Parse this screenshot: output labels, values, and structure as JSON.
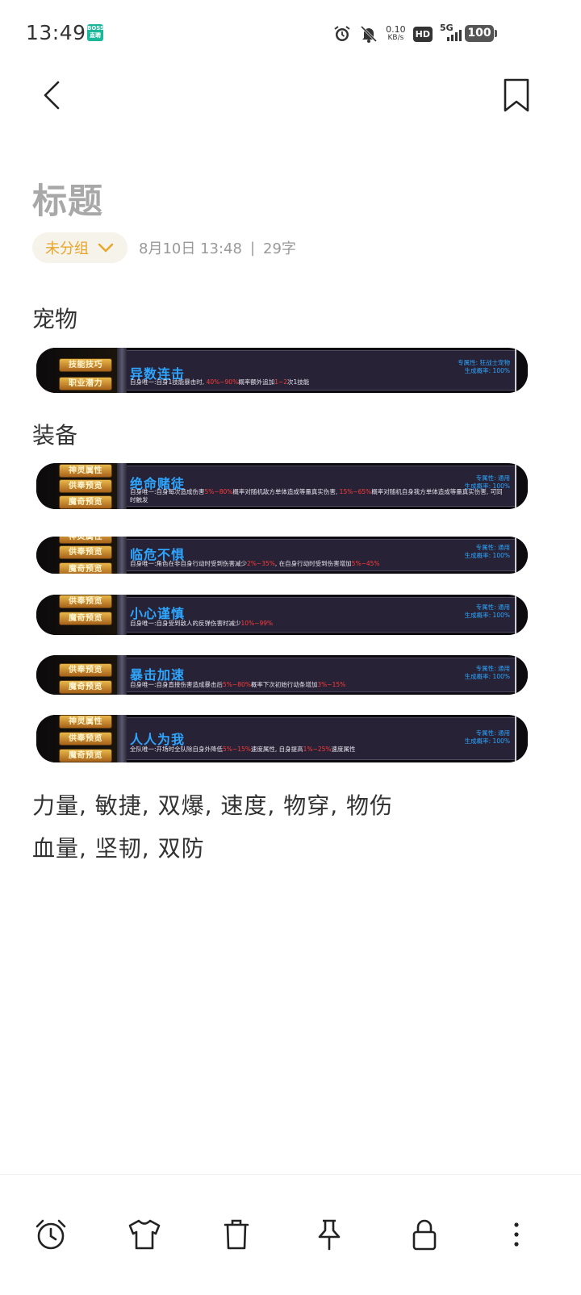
{
  "status_bar": {
    "time": "13:49",
    "app_badge_top": "BOSS",
    "app_badge_bottom": "直聘",
    "net_speed_value": "0.10",
    "net_speed_unit": "KB/s",
    "hd_label": "HD",
    "network": "5G",
    "battery": "100"
  },
  "note": {
    "title": "标题",
    "group": "未分组",
    "date": "8月10日 13:48",
    "separator": "|",
    "word_count": "29字"
  },
  "sections": [
    {
      "heading": "宠物"
    },
    {
      "heading": "装备"
    }
  ],
  "cards": [
    {
      "buttons": [
        "技能技巧",
        "职业潜力"
      ],
      "name": "异数连击",
      "desc": [
        {
          "t": "自身唯一:自身1技能暴击时, ",
          "hl": false
        },
        {
          "t": "40%~90%",
          "hl": true
        },
        {
          "t": "概率额外追加",
          "hl": false
        },
        {
          "t": "1~2",
          "hl": true
        },
        {
          "t": "次1技能",
          "hl": false
        }
      ],
      "attr_line1": "专属性: 狂战士宠物",
      "attr_line2": "生成概率: 100%"
    },
    {
      "buttons": [
        "神灵属性",
        "供奉预览",
        "魔奇预览"
      ],
      "name": "绝命赌徒",
      "desc": [
        {
          "t": "自身唯一:自身每次造成伤害",
          "hl": false
        },
        {
          "t": "5%~80%",
          "hl": true
        },
        {
          "t": "概率对随机敌方单体造成等量真实伤害, ",
          "hl": false
        },
        {
          "t": "15%~65%",
          "hl": true
        },
        {
          "t": "概率对随机自身我方单体造成等量真实伤害, 可同时触发",
          "hl": false
        }
      ],
      "attr_line1": "专属性: 通用",
      "attr_line2": "生成概率: 100%"
    },
    {
      "buttons": [
        "神灵属性",
        "供奉预览",
        "魔奇预览"
      ],
      "name": "临危不惧",
      "desc": [
        {
          "t": "自身唯一:角色在非自身行动时受到伤害减少",
          "hl": false
        },
        {
          "t": "2%~35%",
          "hl": true
        },
        {
          "t": ", 在自身行动时受到伤害增加",
          "hl": false
        },
        {
          "t": "5%~45%",
          "hl": true
        }
      ],
      "attr_line1": "专属性: 通用",
      "attr_line2": "生成概率: 100%"
    },
    {
      "buttons": [
        "供奉预览",
        "魔奇预览"
      ],
      "name": "小心谨慎",
      "desc": [
        {
          "t": "自身唯一:自身受到敌人的反弹伤害时减少",
          "hl": false
        },
        {
          "t": "10%~99%",
          "hl": true
        }
      ],
      "attr_line1": "专属性: 通用",
      "attr_line2": "生成概率: 100%"
    },
    {
      "buttons": [
        "供奉预览",
        "魔奇预览"
      ],
      "name": "暴击加速",
      "desc": [
        {
          "t": "自身唯一:自身直接伤害造成暴击后",
          "hl": false
        },
        {
          "t": "5%~80%",
          "hl": true
        },
        {
          "t": "概率下次初始行动条增加",
          "hl": false
        },
        {
          "t": "3%~15%",
          "hl": true
        }
      ],
      "attr_line1": "专属性: 通用",
      "attr_line2": "生成概率: 100%"
    },
    {
      "buttons": [
        "神灵属性",
        "供奉预览",
        "魔奇预览"
      ],
      "name": "人人为我",
      "desc": [
        {
          "t": "全队唯一:开场时全队除自身外降低",
          "hl": false
        },
        {
          "t": "5%~15%",
          "hl": true
        },
        {
          "t": "速度属性, 自身提高",
          "hl": false
        },
        {
          "t": "1%~25%",
          "hl": true
        },
        {
          "t": "速度属性",
          "hl": false
        }
      ],
      "attr_line1": "专属性: 通用",
      "attr_line2": "生成概率: 100%"
    }
  ],
  "footer_lines": [
    "力量, 敏捷, 双爆, 速度, 物穿, 物伤",
    "血量, 坚韧, 双防"
  ],
  "toolbar": {
    "icons": [
      "alarm-clock-icon",
      "tshirt-icon",
      "trash-icon",
      "pin-icon",
      "lock-icon",
      "more-vertical-icon"
    ]
  },
  "colors": {
    "accent": "#e8a52a",
    "skill_name": "#2ea6ff",
    "highlight": "#ff3b3b"
  }
}
